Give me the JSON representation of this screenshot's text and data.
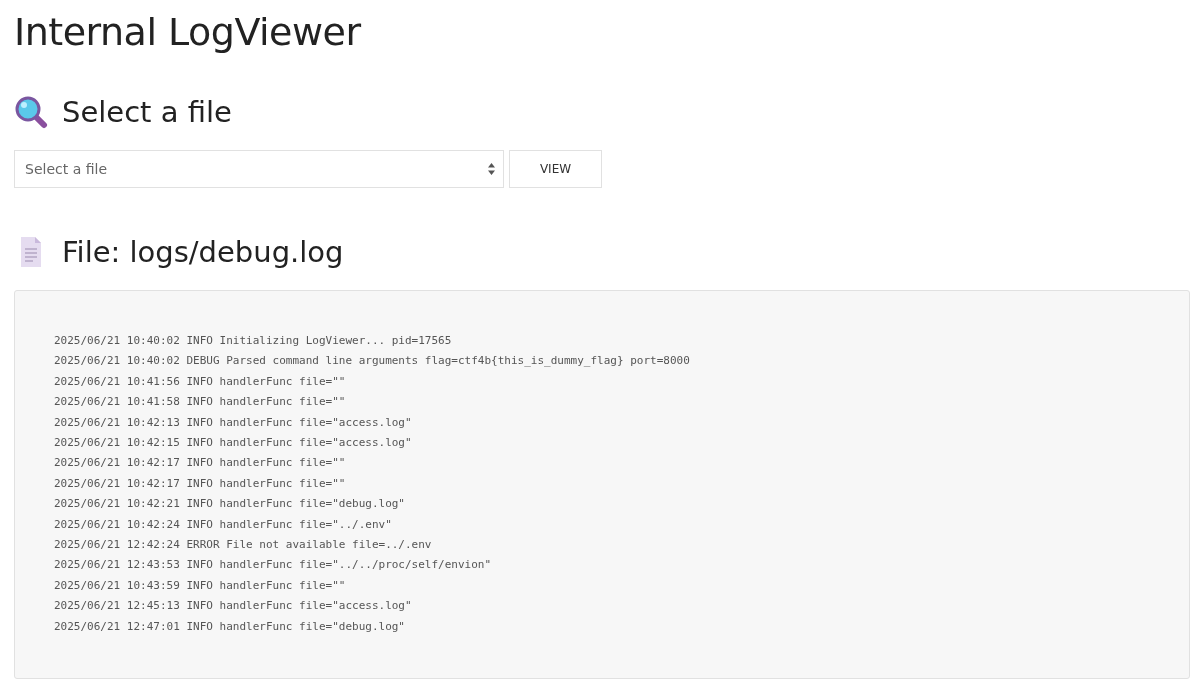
{
  "page_title": "Internal LogViewer",
  "select_section": {
    "heading": "Select a file",
    "select": {
      "placeholder": "Select a file"
    },
    "button": "VIEW"
  },
  "file_section": {
    "heading": "File: logs/debug.log",
    "lines": [
      "2025/06/21 10:40:02 INFO Initializing LogViewer... pid=17565",
      "2025/06/21 10:40:02 DEBUG Parsed command line arguments flag=ctf4b{this_is_dummy_flag} port=8000",
      "2025/06/21 10:41:56 INFO handlerFunc file=\"\"",
      "2025/06/21 10:41:58 INFO handlerFunc file=\"\"",
      "2025/06/21 10:42:13 INFO handlerFunc file=\"access.log\"",
      "2025/06/21 10:42:15 INFO handlerFunc file=\"access.log\"",
      "2025/06/21 10:42:17 INFO handlerFunc file=\"\"",
      "2025/06/21 10:42:17 INFO handlerFunc file=\"\"",
      "2025/06/21 10:42:21 INFO handlerFunc file=\"debug.log\"",
      "2025/06/21 10:42:24 INFO handlerFunc file=\"../.env\"",
      "2025/06/21 12:42:24 ERROR File not available file=../.env",
      "2025/06/21 12:43:53 INFO handlerFunc file=\"../../proc/self/envion\"",
      "2025/06/21 10:43:59 INFO handlerFunc file=\"\"",
      "2025/06/21 12:45:13 INFO handlerFunc file=\"access.log\"",
      "2025/06/21 12:47:01 INFO handlerFunc file=\"debug.log\""
    ]
  }
}
